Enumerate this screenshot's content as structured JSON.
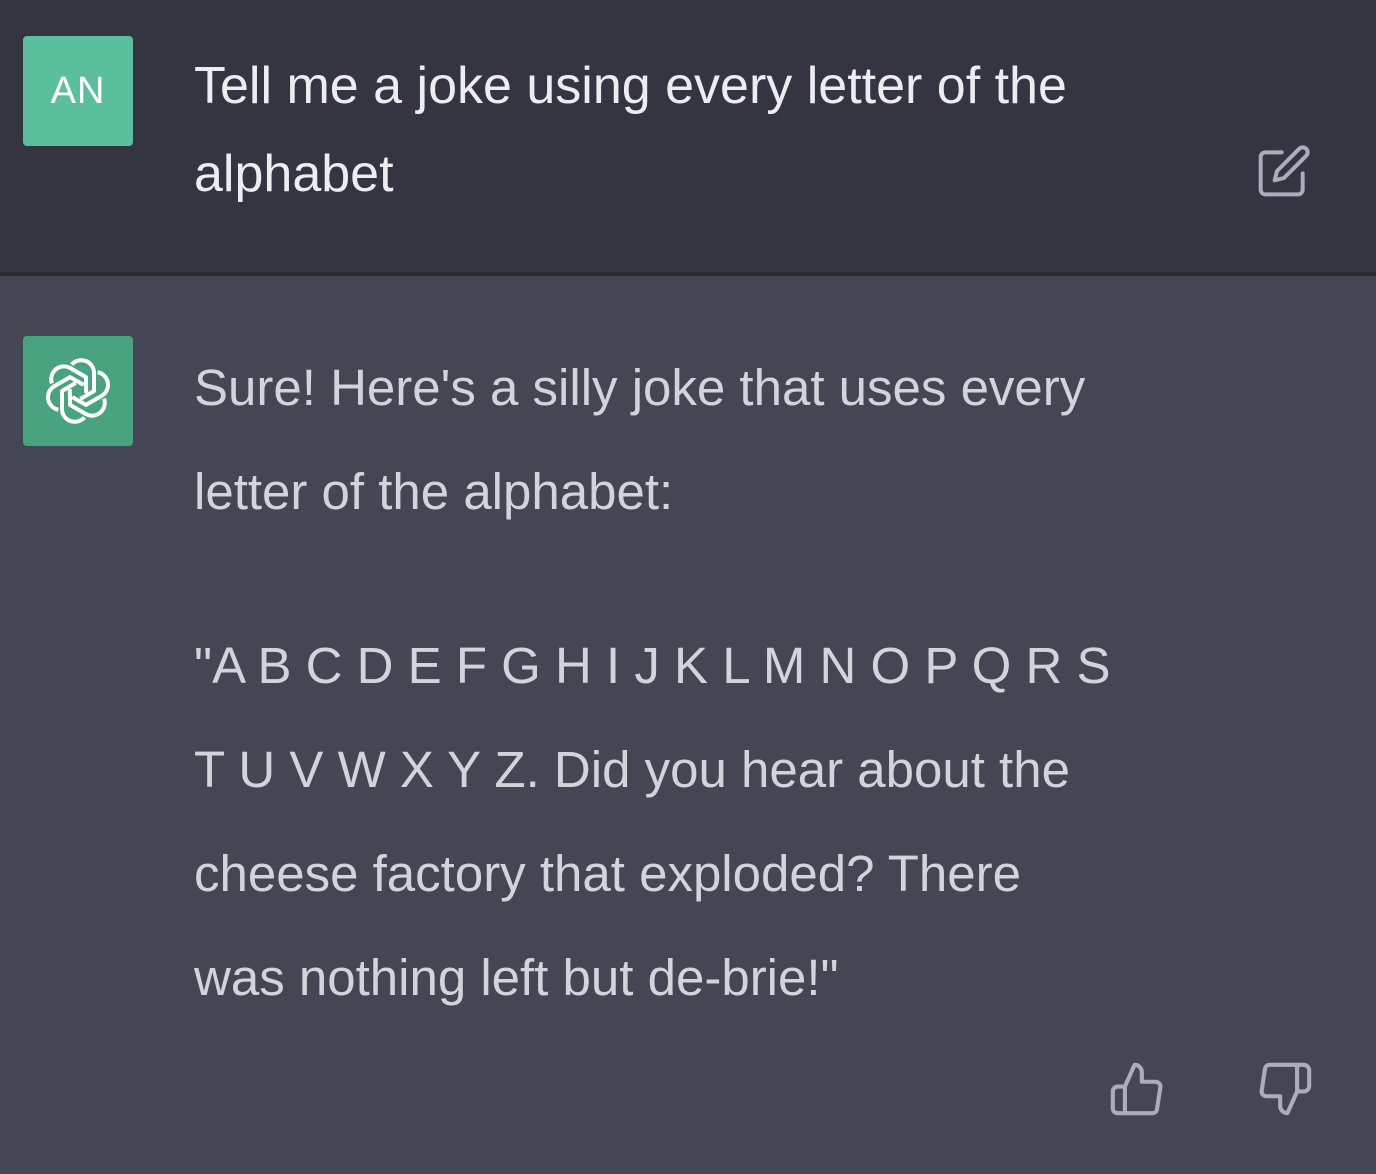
{
  "user_message": {
    "avatar_initials": "AN",
    "text": "Tell me a joke using every letter of the alphabet",
    "edit_icon": "edit-icon"
  },
  "assistant_message": {
    "avatar_icon": "openai-logo-icon",
    "intro": "Sure! Here's a silly joke that uses every letter of the alphabet:",
    "joke": "\"A B C D E F G H I J K L M N O P Q R S T U V W X Y Z. Did you hear about the cheese factory that exploded? There was nothing left but de-brie!\"",
    "feedback_icons": [
      "thumbs-up-icon",
      "thumbs-down-icon"
    ]
  },
  "colors": {
    "user_background": "#343541",
    "assistant_background": "#444654",
    "user_avatar": "#5cbf9b",
    "assistant_avatar": "#4aa37f",
    "icon_color": "#acacbe"
  }
}
